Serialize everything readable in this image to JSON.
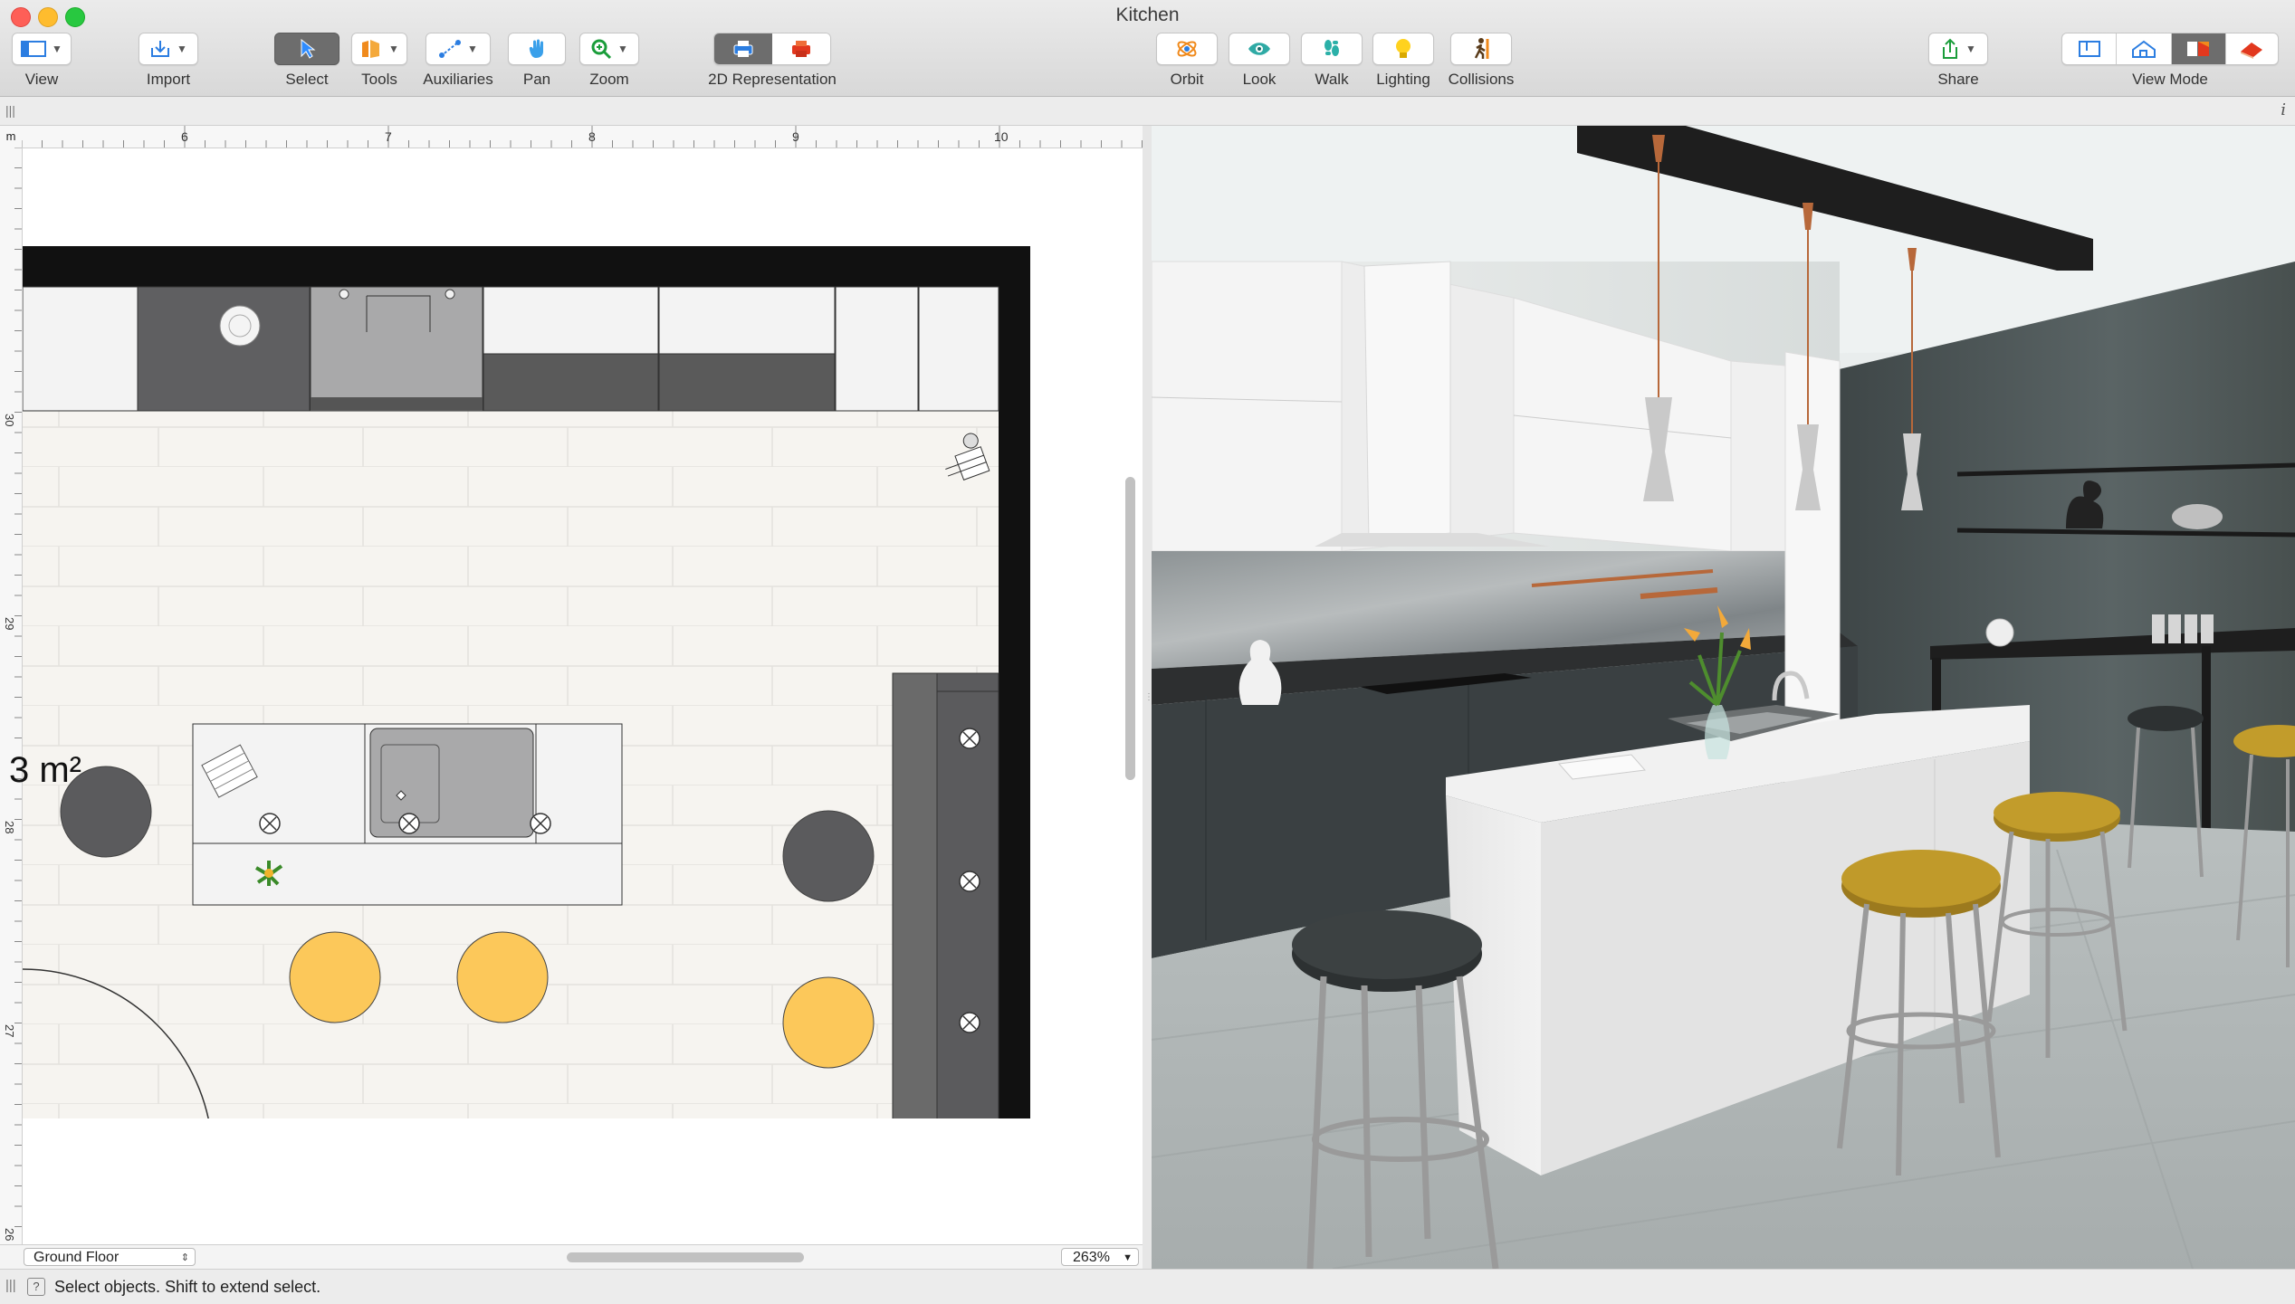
{
  "window": {
    "title": "Kitchen"
  },
  "toolbar": {
    "view": "View",
    "import": "Import",
    "select": "Select",
    "tools": "Tools",
    "auxiliaries": "Auxiliaries",
    "pan": "Pan",
    "zoom": "Zoom",
    "representation_2d": "2D Representation",
    "orbit": "Orbit",
    "look": "Look",
    "walk": "Walk",
    "lighting": "Lighting",
    "collisions": "Collisions",
    "share": "Share",
    "view_mode": "View Mode"
  },
  "ruler": {
    "unit": "m",
    "top_ticks": [
      "6",
      "7",
      "8",
      "9",
      "10"
    ],
    "left_ticks": [
      "30",
      "29",
      "28",
      "27",
      "26"
    ]
  },
  "plan": {
    "area_label": "3 m²",
    "floor": "Ground Floor",
    "zoom": "263%"
  },
  "status": {
    "text": "Select objects. Shift to extend select."
  },
  "colors": {
    "accent_stool": "#fcc85a",
    "dark_stool": "#5b5b5d",
    "wall": "#111111",
    "cabinet_dark": "#585858",
    "select_button": "#6d6d6d"
  }
}
